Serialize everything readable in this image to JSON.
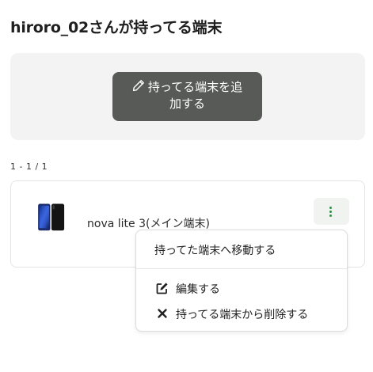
{
  "page": {
    "title": "hiroro_02さんが持ってる端末"
  },
  "add_panel": {
    "button_line1": "持ってる端末を追",
    "button_line2": "加する",
    "button_icon": "pencil-icon"
  },
  "results": {
    "count_text": "1 - 1 / 1"
  },
  "device": {
    "name": "nova lite 3(メイン端末)",
    "thumbnail_icon": "smartphone-icon",
    "menu_button_icon": "kebab-menu-icon"
  },
  "menu": {
    "items": [
      {
        "label": "持ってた端末へ移動する",
        "icon": ""
      },
      {
        "label": "編集する",
        "icon": "edit-icon"
      },
      {
        "label": "持ってる端末から削除する",
        "icon": "close-icon"
      }
    ]
  },
  "colors": {
    "button_bg": "#575a57",
    "panel_bg": "#f3f3f3",
    "kebab_accent": "#2f8f44"
  }
}
